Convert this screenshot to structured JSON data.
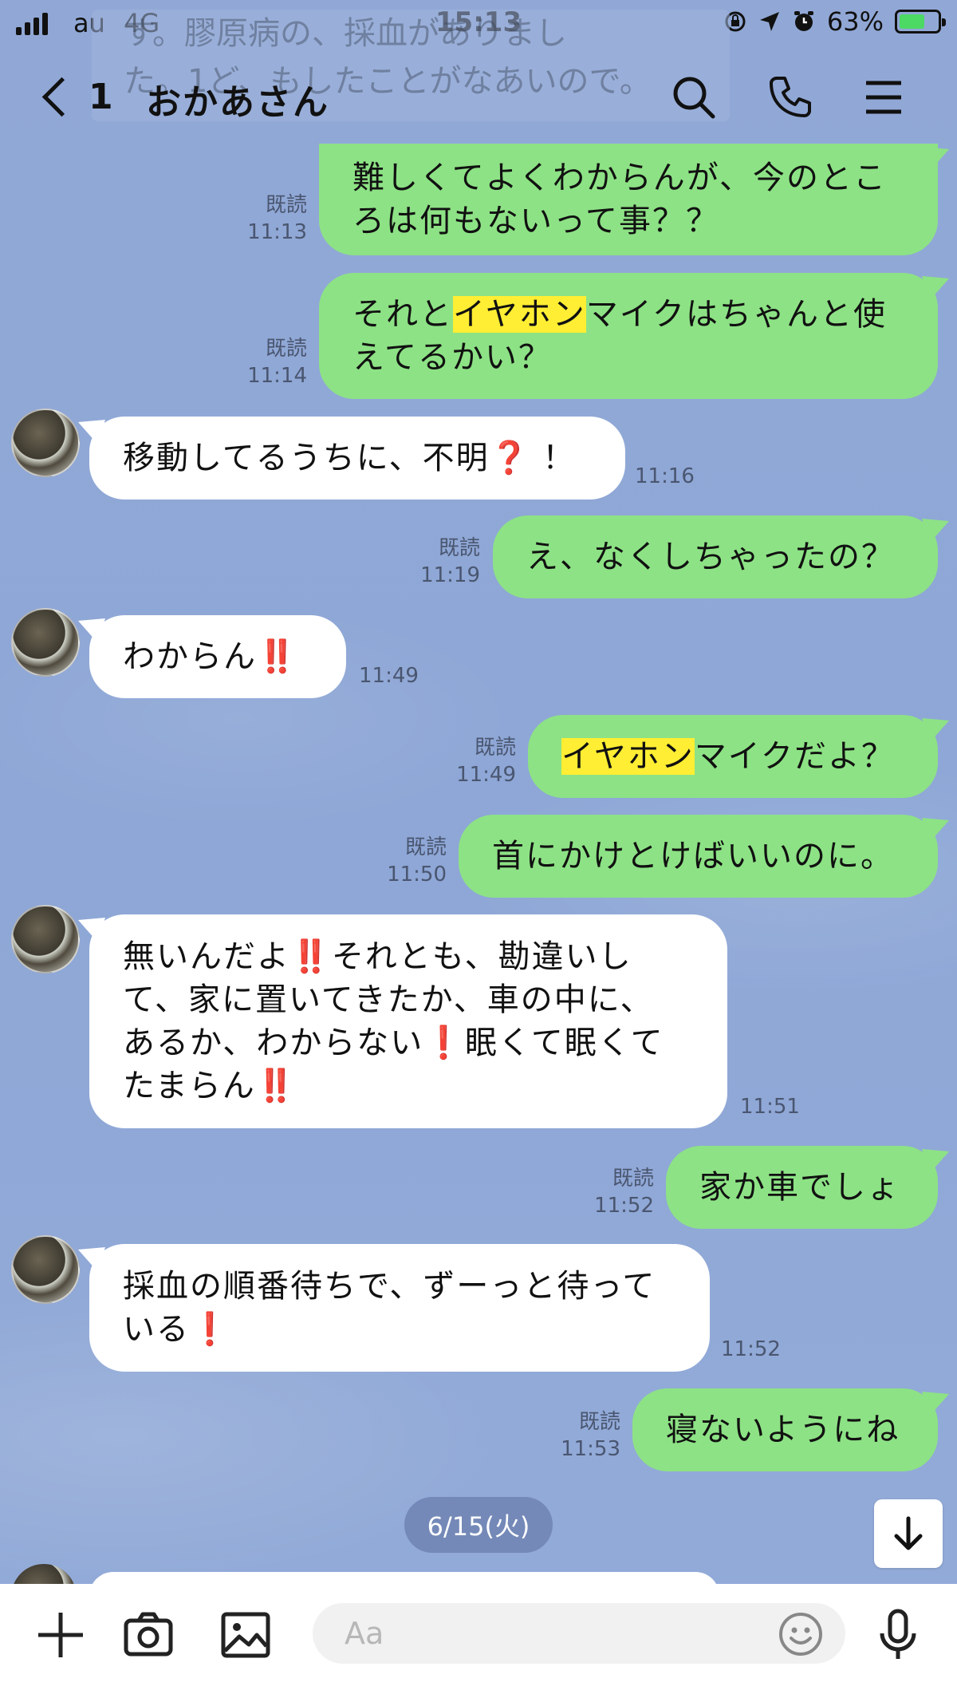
{
  "status_bar": {
    "carrier": "au",
    "network": "4G",
    "time": "15:13",
    "battery": "63%"
  },
  "header": {
    "faded_preview_line1": "す。膠原病の、採血がありまし",
    "faded_preview_line2": "た。1ど、もしたことがなあいので。",
    "back_count": "1",
    "title": "おかあさん",
    "search_icon": "search-icon",
    "call_icon": "phone-icon",
    "menu_icon": "menu-icon"
  },
  "messages": [
    {
      "id": "m1",
      "side": "out",
      "read": "既読",
      "time": "11:13",
      "text": "難しくてよくわからんが、今のとこ\nろは何もないって事？？"
    },
    {
      "id": "m2",
      "side": "out",
      "read": "既読",
      "time": "11:14",
      "pre": "それと",
      "hl": "イヤホン",
      "post": "マイクはちゃんと使\nえてるかい？"
    },
    {
      "id": "m3",
      "side": "in",
      "time": "11:16",
      "text": "移動してるうちに、不明",
      "emoji": "❓",
      "post": "！"
    },
    {
      "id": "m4",
      "side": "out",
      "read": "既読",
      "time": "11:19",
      "text": "え、なくしちゃったの？"
    },
    {
      "id": "m5",
      "side": "in",
      "time": "11:49",
      "text": "わからん",
      "emoji": "‼️"
    },
    {
      "id": "m6",
      "side": "out",
      "read": "既読",
      "time": "11:49",
      "pre": "",
      "hl": "イヤホン",
      "post": "マイクだよ？"
    },
    {
      "id": "m7",
      "side": "out",
      "read": "既読",
      "time": "11:50",
      "text": "首にかけとけばいいのに。"
    },
    {
      "id": "m8",
      "side": "in",
      "time": "11:51",
      "l1a": "無いんだよ",
      "e1": "‼️",
      "l1b": "それとも、勘違いし",
      "l2": "て、家に置いてきたか、車の中に、",
      "l3a": "あるか、わからない",
      "e2": "❗",
      "l3b": "眠くて眠くて",
      "l4a": "たまらん",
      "e3": "‼️"
    },
    {
      "id": "m9",
      "side": "out",
      "read": "既読",
      "time": "11:52",
      "text": "家か車でしょ"
    },
    {
      "id": "m10",
      "side": "in",
      "time": "11:52",
      "l1": "採血の順番待ちで、ずーっと待って",
      "l2a": "いる",
      "e1": "❗"
    },
    {
      "id": "m11",
      "side": "out",
      "read": "既読",
      "time": "11:53",
      "text": "寝ないようにね"
    }
  ],
  "date_separator": "6/15(火)",
  "input_bar": {
    "placeholder": "Aa",
    "plus_icon": "plus-icon",
    "camera_icon": "camera-icon",
    "image_icon": "image-icon",
    "emoji_icon": "emoji-icon",
    "mic_icon": "microphone-icon"
  },
  "colors": {
    "outgoing_bubble": "#8de285",
    "incoming_bubble": "#ffffff",
    "highlight": "#ffee33",
    "chat_background": "#8fa7d5"
  }
}
